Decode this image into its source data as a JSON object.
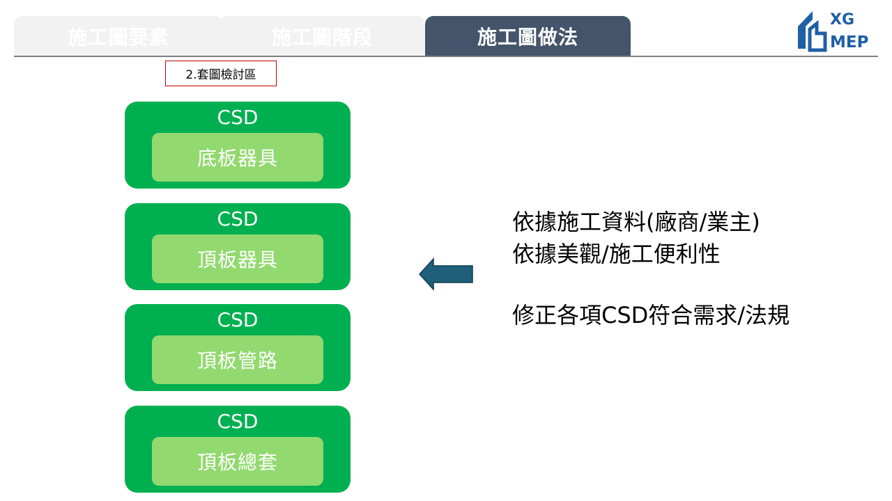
{
  "tabs": [
    {
      "label": "施工圖要素",
      "active": false
    },
    {
      "label": "施工圖階段",
      "active": false
    },
    {
      "label": "施工圖做法",
      "active": true
    }
  ],
  "logo": {
    "line1": "XG",
    "line2": "MEP",
    "color": "#1f5fa6"
  },
  "section_label": "2.套圖檢討區",
  "cards": [
    {
      "title": "CSD",
      "subtitle": "底板器具"
    },
    {
      "title": "CSD",
      "subtitle": "頂板器具"
    },
    {
      "title": "CSD",
      "subtitle": "頂板管路"
    },
    {
      "title": "CSD",
      "subtitle": "頂板總套"
    }
  ],
  "notes": {
    "line1": "依據施工資料(廠商/業主)",
    "line2": "依據美觀/施工便利性",
    "line3": "修正各項CSD符合需求/法規"
  },
  "colors": {
    "tab_active": "#44546a",
    "tab_inactive": "#f2f2f2",
    "card_outer": "#00b050",
    "card_inner": "#92d96f",
    "arrow_fill": "#1f5f7a",
    "section_border": "#c00000"
  },
  "icons": {
    "logo": "building-logo-icon",
    "arrow": "left-arrow-icon"
  }
}
